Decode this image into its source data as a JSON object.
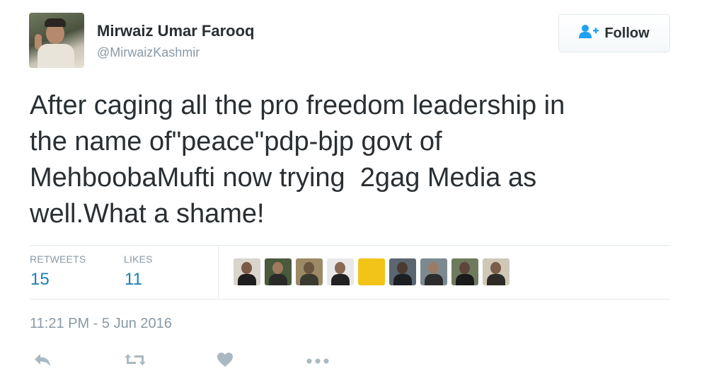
{
  "author": {
    "name": "Mirwaiz Umar Farooq",
    "handle": "@MirwaizKashmir"
  },
  "follow_button": {
    "label": "Follow",
    "icon": "add-person-icon"
  },
  "tweet": {
    "text": "After caging all the pro freedom leadership in\nthe name of\"peace\"pdp-bjp govt of\nMehboobaMufti now trying  2gag Media as\nwell.What a shame!"
  },
  "stats": {
    "retweets_label": "RETWEETS",
    "retweets_count": "15",
    "likes_label": "LIKES",
    "likes_count": "11"
  },
  "likers": [
    {
      "bg": "#d9d4cc",
      "head": "#7b5a45",
      "torso": "#1e1e1e"
    },
    {
      "bg": "#4a5a3c",
      "head": "#a07a5e",
      "torso": "#2a2a28"
    },
    {
      "bg": "#9b8a64",
      "head": "#6a5440",
      "torso": "#3b3a30"
    },
    {
      "bg": "#e8e8e8",
      "head": "#8a6a55",
      "torso": "#222222"
    },
    {
      "bg": "#f2c418",
      "head": "#f2c418",
      "torso": "#f2c418"
    },
    {
      "bg": "#5a6670",
      "head": "#4a3a30",
      "torso": "#1b1f24"
    },
    {
      "bg": "#7c8a90",
      "head": "#9a7c66",
      "torso": "#2c2c2c"
    },
    {
      "bg": "#6e7a5c",
      "head": "#5c463a",
      "torso": "#1a1a1a"
    },
    {
      "bg": "#cfc8b6",
      "head": "#7a5c48",
      "torso": "#2e2b26"
    }
  ],
  "timestamp": "11:21 PM - 5 Jun 2016",
  "actions": [
    {
      "name": "reply-icon"
    },
    {
      "name": "retweet-icon"
    },
    {
      "name": "like-icon"
    },
    {
      "name": "more-icon"
    }
  ],
  "colors": {
    "text": "#292f33",
    "muted": "#8899a6",
    "count_blue": "#1b7fb5",
    "action_gray": "#aab8c2",
    "follow_icon_blue": "#1da1f2"
  }
}
